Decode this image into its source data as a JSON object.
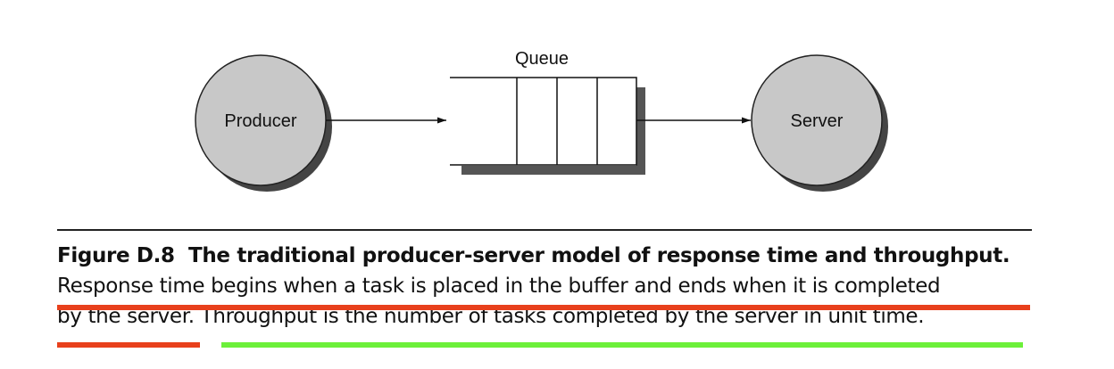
{
  "diagram": {
    "queue_label": "Queue",
    "producer_label": "Producer",
    "server_label": "Server"
  },
  "caption": {
    "figure_number": "Figure D.8",
    "title": "The traditional producer-server model of response time and throughput.",
    "line2": "Response time begins when a task is placed in the buffer and ends when it is completed",
    "line3_part1": "by the server.",
    "line3_part2": " Throughput is the number of tasks completed by the server in unit time."
  },
  "colors": {
    "node_fill": "#c8c8c8",
    "shadow": "#555555",
    "highlight_red": "#e8401c",
    "highlight_green": "#6cf03a"
  }
}
